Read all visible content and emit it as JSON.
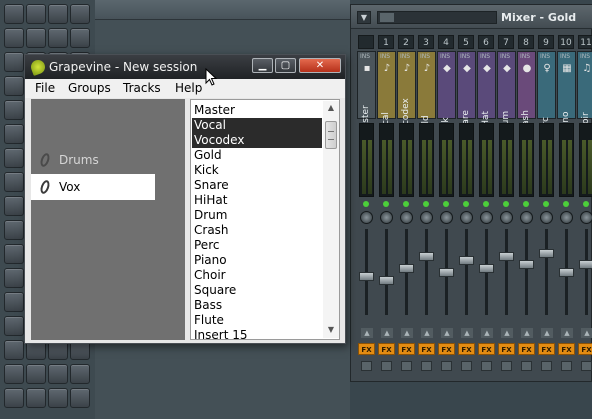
{
  "grapevine": {
    "title": "Grapevine - New session",
    "menu": [
      "File",
      "Groups",
      "Tracks",
      "Help"
    ],
    "groups": [
      {
        "label": "Drums"
      },
      {
        "label": "Vox"
      }
    ],
    "tracks": [
      "Master",
      "Vocal",
      "Vocodex",
      "Gold",
      "Kick",
      "Snare",
      "HiHat",
      "Drum",
      "Crash",
      "Perc",
      "Piano",
      "Choir",
      "Square",
      "Bass",
      "Flute",
      "Insert 15"
    ],
    "selected_tracks": [
      "Vocal",
      "Vocodex"
    ],
    "window_buttons": {
      "minimize": "▁",
      "maximize": "▢",
      "close": "✕"
    }
  },
  "mixer": {
    "title": "Mixer - Gold",
    "menu_glyph": "▼",
    "channels": [
      {
        "num": "",
        "name": "Master",
        "icon": "▪",
        "color": "#4b555b",
        "fader": 0.55
      },
      {
        "num": "1",
        "name": "Vocal",
        "icon": "♪",
        "color": "#8a7a3a",
        "fader": 0.6
      },
      {
        "num": "2",
        "name": "Vocodex",
        "icon": "♪",
        "color": "#8a7a3a",
        "fader": 0.45
      },
      {
        "num": "3",
        "name": "Gold",
        "icon": "♪",
        "color": "#8a7a3a",
        "fader": 0.3
      },
      {
        "num": "4",
        "name": "Kick",
        "icon": "◆",
        "color": "#5a4a7a",
        "fader": 0.5
      },
      {
        "num": "5",
        "name": "Snare",
        "icon": "◆",
        "color": "#5a4a7a",
        "fader": 0.35
      },
      {
        "num": "6",
        "name": "HiHat",
        "icon": "◆",
        "color": "#5a4a7a",
        "fader": 0.45
      },
      {
        "num": "7",
        "name": "Drum",
        "icon": "◆",
        "color": "#5a4a7a",
        "fader": 0.3
      },
      {
        "num": "8",
        "name": "Crash",
        "icon": "●",
        "color": "#6a4a7a",
        "fader": 0.4
      },
      {
        "num": "9",
        "name": "Perc",
        "icon": "♀",
        "color": "#3a6a7a",
        "fader": 0.25
      },
      {
        "num": "10",
        "name": "Piano",
        "icon": "▦",
        "color": "#3a6a7a",
        "fader": 0.5
      },
      {
        "num": "11",
        "name": "Choir",
        "icon": "♫",
        "color": "#3a6a7a",
        "fader": 0.4
      }
    ],
    "ins_label": "INS",
    "fx_label": "FX"
  },
  "colors": {
    "mixer_bg": "#40494f",
    "fx_orange": "#e38c12",
    "led_green": "#4ccf3a",
    "selection": "#2b2b2b"
  }
}
